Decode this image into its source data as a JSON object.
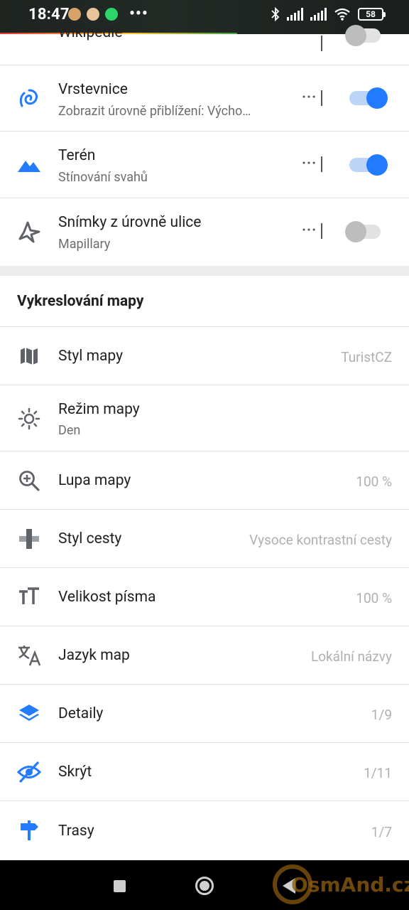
{
  "status_bar": {
    "time": "18:47",
    "more": "•••",
    "battery": "58"
  },
  "layers": [
    {
      "title": "Wikipedie",
      "toggle": "off",
      "partial": true
    },
    {
      "title": "Vrstevnice",
      "subtitle": "Zobrazit úrovně přiblížení: Výcho…",
      "toggle": "on",
      "icon": "contour-lines-icon"
    },
    {
      "title": "Terén",
      "subtitle": "Stínování svahů",
      "toggle": "on",
      "icon": "terrain-icon"
    },
    {
      "title": "Snímky z úrovně ulice",
      "subtitle": "Mapillary",
      "toggle": "off",
      "icon": "street-level-imagery-icon"
    }
  ],
  "section": {
    "title": "Vykreslování mapy",
    "items": [
      {
        "title": "Styl mapy",
        "value": "TuristCZ",
        "icon": "map-style-icon"
      },
      {
        "title": "Režim mapy",
        "subtitle": "Den",
        "icon": "day-mode-sun-icon"
      },
      {
        "title": "Lupa mapy",
        "value": "100 %",
        "icon": "map-magnifier-icon"
      },
      {
        "title": "Styl cesty",
        "value": "Vysoce kontrastní cesty",
        "icon": "road-style-icon"
      },
      {
        "title": "Velikost písma",
        "value": "100 %",
        "icon": "text-size-icon"
      },
      {
        "title": "Jazyk map",
        "value": "Lokální názvy",
        "icon": "map-language-icon"
      },
      {
        "title": "Detaily",
        "value": "1/9",
        "icon": "details-layers-icon"
      },
      {
        "title": "Skrýt",
        "value": "1/11",
        "icon": "hide-eye-icon"
      },
      {
        "title": "Trasy",
        "value": "1/7",
        "icon": "routes-signpost-icon"
      }
    ]
  },
  "dots_label": "···",
  "watermark": "OsmAnd.cz",
  "colors": {
    "accent": "#237bff",
    "icon_gray": "#5f6368",
    "text_primary": "#212121",
    "text_secondary": "#6d6d6d",
    "value_text": "#b0b0b0"
  }
}
